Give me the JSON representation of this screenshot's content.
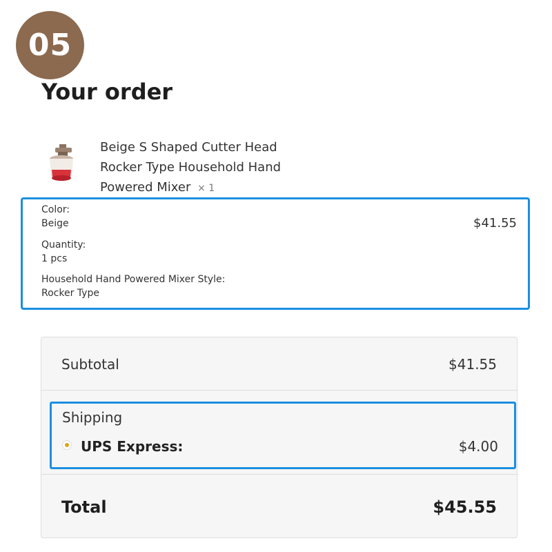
{
  "step_badge": "05",
  "title": "Your order",
  "product": {
    "name": "Beige S Shaped Cutter Head Rocker Type Household Hand Powered Mixer",
    "quantity_suffix": "× 1",
    "price": "$41.55",
    "thumbnail": "hand-mixer-product-image",
    "variants": [
      {
        "label": "Color:",
        "value": "Beige"
      },
      {
        "label": "Quantity:",
        "value": "1 pcs"
      },
      {
        "label": "Household Hand Powered Mixer Style:",
        "value": "Rocker Type"
      }
    ]
  },
  "summary": {
    "subtotal_label": "Subtotal",
    "subtotal_value": "$41.55",
    "shipping_label": "Shipping",
    "shipping_option": "UPS Express:",
    "shipping_price": "$4.00",
    "total_label": "Total",
    "total_value": "$45.55"
  },
  "colors": {
    "badge": "#8c6a4f",
    "highlight_border": "#1a8fe0",
    "radio_selected": "#e0a418",
    "card_background": "#f6f6f6"
  }
}
